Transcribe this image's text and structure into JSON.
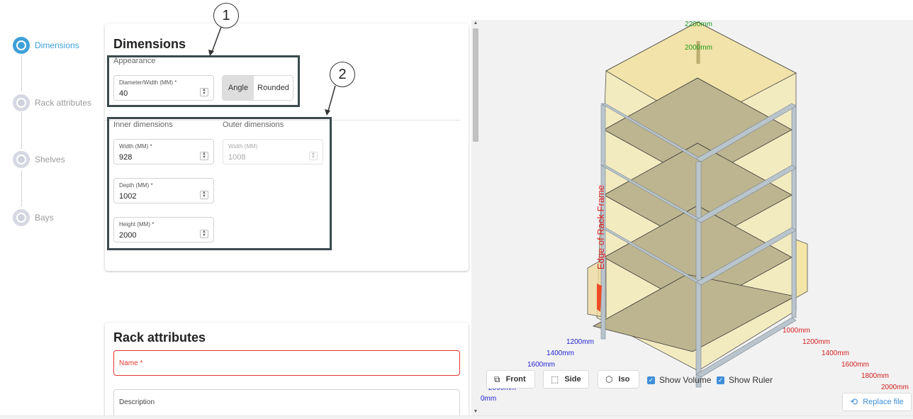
{
  "stepper": {
    "steps": [
      {
        "label": "Dimensions",
        "active": true
      },
      {
        "label": "Rack attributes",
        "active": false
      },
      {
        "label": "Shelves",
        "active": false
      },
      {
        "label": "Bays",
        "active": false
      }
    ]
  },
  "dimensions_card": {
    "title": "Dimensions",
    "appearance_label": "Appearance",
    "diameter": {
      "label": "Diameter/Width (MM) *",
      "value": "40"
    },
    "shape_toggle": {
      "options": [
        "Angle",
        "Rounded"
      ],
      "selected": "Angle"
    },
    "inner_label": "Inner dimensions",
    "outer_label": "Outer dimensions",
    "inner_width": {
      "label": "Width (MM) *",
      "value": "928"
    },
    "inner_depth": {
      "label": "Depth (MM) *",
      "value": "1002"
    },
    "inner_height": {
      "label": "Height (MM) *",
      "value": "2000"
    },
    "outer_width": {
      "label": "Width (MM)",
      "value": "1008"
    }
  },
  "annotations": {
    "one": "1",
    "two": "2"
  },
  "rack_card": {
    "title": "Rack attributes",
    "name_placeholder": "Name *",
    "description_placeholder": "Description"
  },
  "viewer": {
    "buttons": {
      "front": "Front",
      "side": "Side",
      "iso": "Iso"
    },
    "checkboxes": {
      "show_volume": "Show Volume",
      "show_ruler": "Show Ruler"
    },
    "replace_file": "Replace file",
    "rack_frame_label": "Edge of Rack Frame",
    "ruler_height": [
      "2200mm",
      "2000mm"
    ],
    "ruler_blue": [
      "1200mm",
      "1400mm",
      "1600mm",
      "2000mm",
      "0mm"
    ],
    "ruler_red": [
      "1000mm",
      "1200mm",
      "1400mm",
      "1600mm",
      "1800mm",
      "2000mm"
    ],
    "colors": {
      "ruler_blue": "#1f1fd1",
      "ruler_red": "#d11f1f",
      "ruler_green": "#1f9a1f",
      "volume": "#f3e7a4",
      "shelf": "#bdb58f",
      "frame": "#b9c4cc"
    },
    "icons": {
      "front": "front-view-icon",
      "side": "side-view-icon",
      "iso": "iso-cube-icon",
      "replace": "replace-file-icon"
    }
  }
}
